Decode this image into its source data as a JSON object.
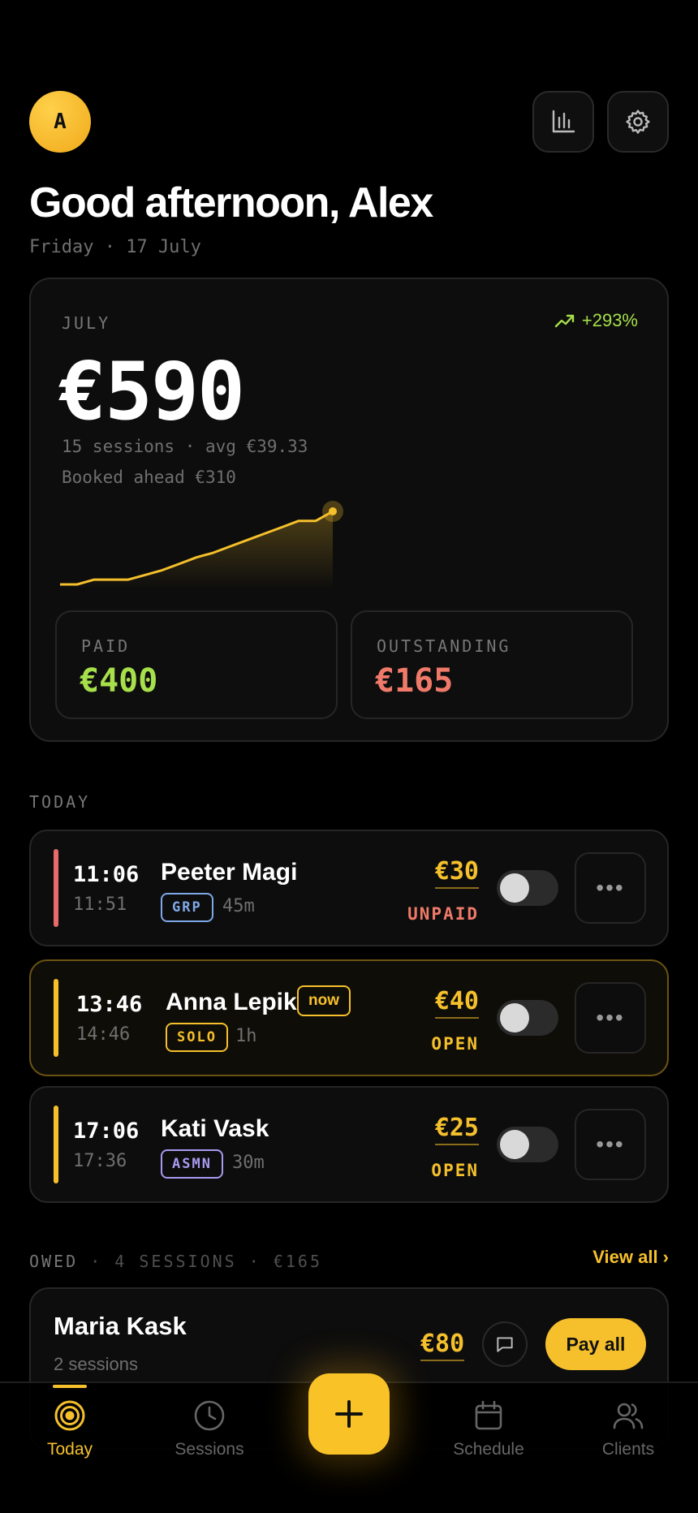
{
  "header": {
    "avatar_initial": "A",
    "greeting": "Good afternoon, Alex",
    "date": "Friday · 17 July"
  },
  "summary": {
    "month": "JULY",
    "trend": "+293%",
    "total": "€590",
    "sessions_line": "15 sessions · avg €39.33",
    "booked_line": "Booked ahead €310",
    "paid_label": "PAID",
    "paid_value": "€400",
    "outstanding_label": "OUTSTANDING",
    "outstanding_value": "€165"
  },
  "today": {
    "label": "TODAY",
    "sessions": [
      {
        "start": "11:06",
        "end": "11:51",
        "client": "Peeter Magi",
        "tag": "GRP",
        "duration": "45m",
        "amount": "€30",
        "status": "UNPAID"
      },
      {
        "start": "13:46",
        "end": "14:46",
        "client": "Anna Lepik",
        "badge": "now",
        "tag": "SOLO",
        "duration": "1h",
        "amount": "€40",
        "status": "OPEN"
      },
      {
        "start": "17:06",
        "end": "17:36",
        "client": "Kati Vask",
        "tag": "ASMN",
        "duration": "30m",
        "amount": "€25",
        "status": "OPEN"
      }
    ]
  },
  "owed": {
    "label": "OWED",
    "meta": "· 4 SESSIONS · €165",
    "view_all": "View all ›",
    "client": "Maria Kask",
    "sessions": "2 sessions",
    "amount": "€80",
    "pay_label": "Pay all"
  },
  "nav": {
    "today": "Today",
    "sessions": "Sessions",
    "schedule": "Schedule",
    "clients": "Clients"
  },
  "colors": {
    "accent": "#f5c02c",
    "paid": "#a6e04a",
    "outstanding": "#f07a6a",
    "grp": "#7fa8e8",
    "asmn": "#a99af0"
  },
  "chart_data": {
    "type": "line",
    "x": [
      1,
      2,
      3,
      4,
      5,
      6,
      7,
      8,
      9,
      10,
      11,
      12,
      13,
      14,
      15,
      16,
      17
    ],
    "values": [
      0,
      0,
      30,
      30,
      30,
      60,
      90,
      130,
      170,
      200,
      240,
      280,
      320,
      360,
      400,
      400,
      460
    ],
    "current_point_index": 16
  }
}
